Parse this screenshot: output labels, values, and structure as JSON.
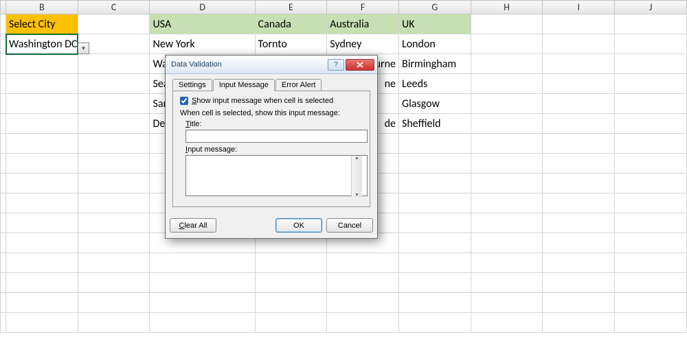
{
  "columns": [
    "B",
    "C",
    "D",
    "E",
    "F",
    "G",
    "H",
    "I",
    "J"
  ],
  "grid": {
    "B1": "Select City",
    "B2": "Washington DC",
    "D1": "USA",
    "E1": "Canada",
    "F1": "Australia",
    "G1": "UK",
    "D2": "New York",
    "E2": "Tornto",
    "F2": "Sydney",
    "G2": "London",
    "D3": "Wa",
    "F3_tail": "urne",
    "G3": "Birmingham",
    "D4": "Sea",
    "F4_tail": "ne",
    "G4": "Leeds",
    "D5": "San",
    "G5": "Glasgow",
    "D6": "Det",
    "F6_tail": "de",
    "G6": "Sheffield"
  },
  "dialog": {
    "title": "Data Validation",
    "tabs": {
      "settings": "Settings",
      "input": "Input Message",
      "error": "Error Alert"
    },
    "show_msg_label_pre": "S",
    "show_msg_label_rest": "how input message when cell is selected",
    "when_selected": "When cell is selected, show this input message:",
    "title_pre": "T",
    "title_rest": "itle:",
    "msg_pre": "I",
    "msg_rest": "nput message:",
    "title_value": "",
    "message_value": "",
    "clear_pre": "C",
    "clear_rest": "lear All",
    "ok": "OK",
    "cancel": "Cancel",
    "show_checked": true
  }
}
